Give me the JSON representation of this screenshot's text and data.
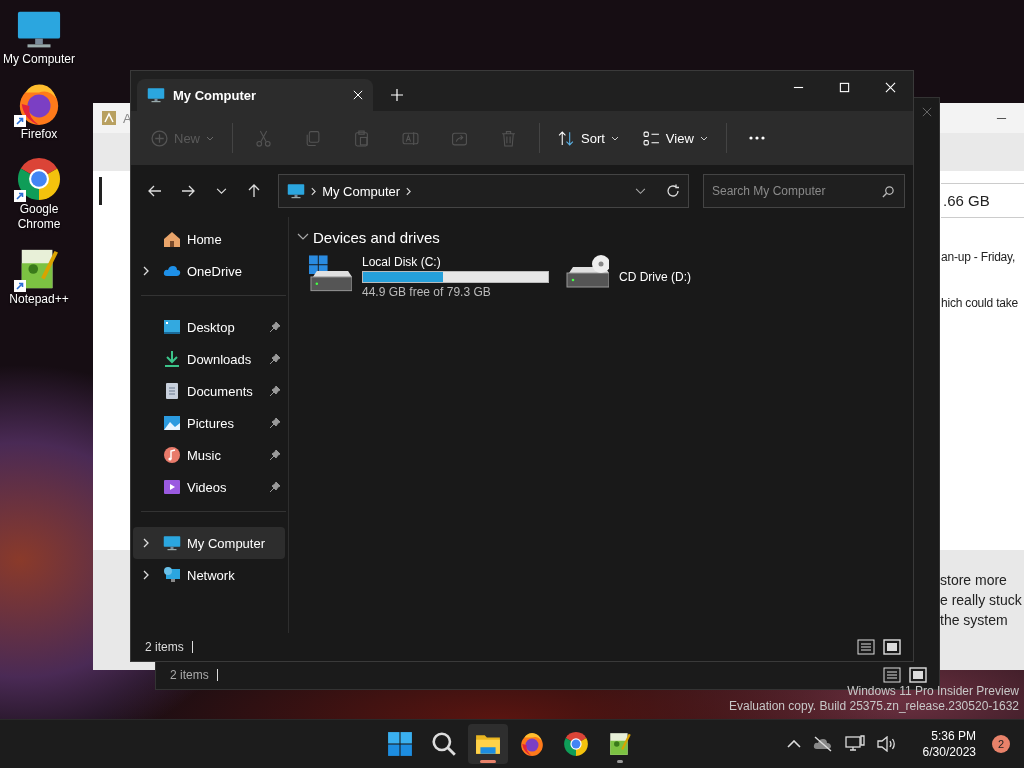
{
  "desktop_icons": [
    {
      "label": "My Computer",
      "kind": "computer",
      "shortcut": false
    },
    {
      "label": "Firefox",
      "kind": "firefox",
      "shortcut": true
    },
    {
      "label": "Google Chrome",
      "kind": "chrome",
      "shortcut": true
    },
    {
      "label": "Notepad++",
      "kind": "notepad",
      "shortcut": true
    }
  ],
  "background_window": {
    "title": "A",
    "size_value": ".66 GB",
    "lines": [
      "an-up - Friday,",
      "hich could take"
    ],
    "footer_lines": [
      "store more",
      "e really stuck",
      "the system"
    ]
  },
  "back_explorer": {
    "status": "2 items"
  },
  "explorer": {
    "tabs": [
      {
        "title": "My Computer",
        "selected": true
      }
    ],
    "toolbar": [
      {
        "kind": "new",
        "label": "New",
        "disabled": true,
        "dropdown": true
      },
      {
        "kind": "separator"
      },
      {
        "kind": "cut",
        "disabled": true,
        "dropdown": false
      },
      {
        "kind": "copy",
        "disabled": true,
        "dropdown": false
      },
      {
        "kind": "paste",
        "disabled": true,
        "dropdown": false
      },
      {
        "kind": "rename",
        "disabled": true,
        "dropdown": false
      },
      {
        "kind": "share",
        "disabled": true,
        "dropdown": false
      },
      {
        "kind": "delete",
        "disabled": true,
        "dropdown": false
      },
      {
        "kind": "separator"
      },
      {
        "kind": "sort",
        "label": "Sort",
        "disabled": false,
        "dropdown": true
      },
      {
        "kind": "view",
        "label": "View",
        "disabled": false,
        "dropdown": true
      },
      {
        "kind": "separator"
      },
      {
        "kind": "more",
        "disabled": false,
        "dropdown": false
      }
    ],
    "address": {
      "crumbs": [
        "My Computer"
      ]
    },
    "search": {
      "placeholder": "Search My Computer"
    },
    "sidebar": [
      {
        "items": [
          {
            "label": "Home",
            "expandable": false,
            "pinned": false,
            "selected": false
          },
          {
            "label": "OneDrive",
            "expandable": true,
            "pinned": false,
            "selected": false
          }
        ]
      },
      {
        "items": [
          {
            "label": "Desktop",
            "expandable": false,
            "pinned": true,
            "selected": false
          },
          {
            "label": "Downloads",
            "expandable": false,
            "pinned": true,
            "selected": false
          },
          {
            "label": "Documents",
            "expandable": false,
            "pinned": true,
            "selected": false
          },
          {
            "label": "Pictures",
            "expandable": false,
            "pinned": true,
            "selected": false
          },
          {
            "label": "Music",
            "expandable": false,
            "pinned": true,
            "selected": false
          },
          {
            "label": "Videos",
            "expandable": false,
            "pinned": true,
            "selected": false
          }
        ]
      },
      {
        "items": [
          {
            "label": "My Computer",
            "expandable": true,
            "pinned": false,
            "selected": true
          },
          {
            "label": "Network",
            "expandable": true,
            "pinned": false,
            "selected": false
          }
        ]
      }
    ],
    "section": {
      "title": "Devices and drives",
      "expanded": true
    },
    "drives": [
      {
        "name": "Local Disk (C:)",
        "kind": "disk",
        "level": 0.434,
        "free": "44.9 GB free of 79.3 GB"
      },
      {
        "name": "CD Drive (D:)",
        "kind": "cd"
      }
    ],
    "status": "2 items"
  },
  "os_notice": [
    "Windows 11 Pro Insider Preview",
    "Evaluation copy. Build 25375.zn_release.230520-1632"
  ],
  "taskbar": {
    "apps": [
      {
        "kind": "start",
        "active": false,
        "running": false
      },
      {
        "kind": "search",
        "active": false,
        "running": false
      },
      {
        "kind": "explorer",
        "active": true,
        "running": true
      },
      {
        "kind": "firefox",
        "active": false,
        "running": false
      },
      {
        "kind": "chrome",
        "active": false,
        "running": false
      },
      {
        "kind": "notepad",
        "active": false,
        "running": true
      }
    ],
    "time": "5:36 PM",
    "date": "6/30/2023",
    "notifications": "2"
  }
}
